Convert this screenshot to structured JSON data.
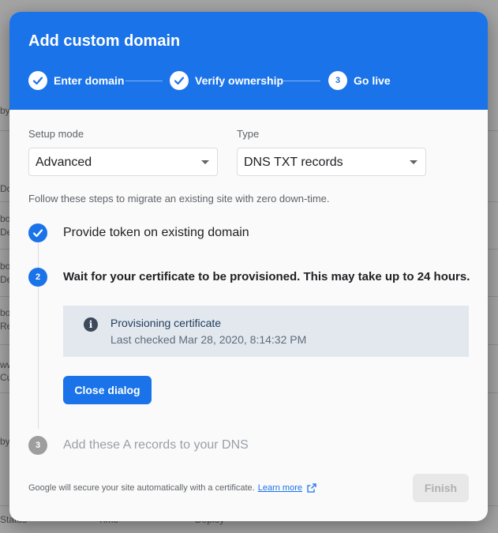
{
  "background": {
    "texts": [
      "by",
      "Do",
      "bo",
      "De",
      "bo",
      "De",
      "bo",
      "Re",
      "ww",
      "Cu",
      "by"
    ],
    "columns": [
      "Status",
      "Time",
      "Deploy"
    ]
  },
  "dialog": {
    "title": "Add custom domain",
    "steps": [
      {
        "label": "Enter domain",
        "state": "done"
      },
      {
        "label": "Verify ownership",
        "state": "done"
      },
      {
        "number": "3",
        "label": "Go live",
        "state": "current"
      }
    ],
    "setup_mode": {
      "label": "Setup mode",
      "value": "Advanced"
    },
    "type": {
      "label": "Type",
      "value": "DNS TXT records"
    },
    "intro": "Follow these steps to migrate an existing site with zero down-time.",
    "vsteps": [
      {
        "title": "Provide token on existing domain",
        "state": "done"
      },
      {
        "number": "2",
        "title": "Wait for your certificate to be provisioned. This may take up to 24 hours.",
        "state": "active"
      },
      {
        "number": "3",
        "title": "Add these A records to your DNS",
        "state": "pending"
      }
    ],
    "info": {
      "icon": "info-icon",
      "title": "Provisioning certificate",
      "subtitle": "Last checked Mar 28, 2020, 8:14:32 PM"
    },
    "close_button": "Close dialog",
    "footer": {
      "note": "Google will secure your site automatically with a certificate.",
      "link": "Learn more"
    },
    "finish_button": "Finish"
  },
  "colors": {
    "accent": "#1a73e8",
    "header": "#1a73e8",
    "info_bg": "#e3e8ef",
    "pending": "#9e9e9e"
  }
}
